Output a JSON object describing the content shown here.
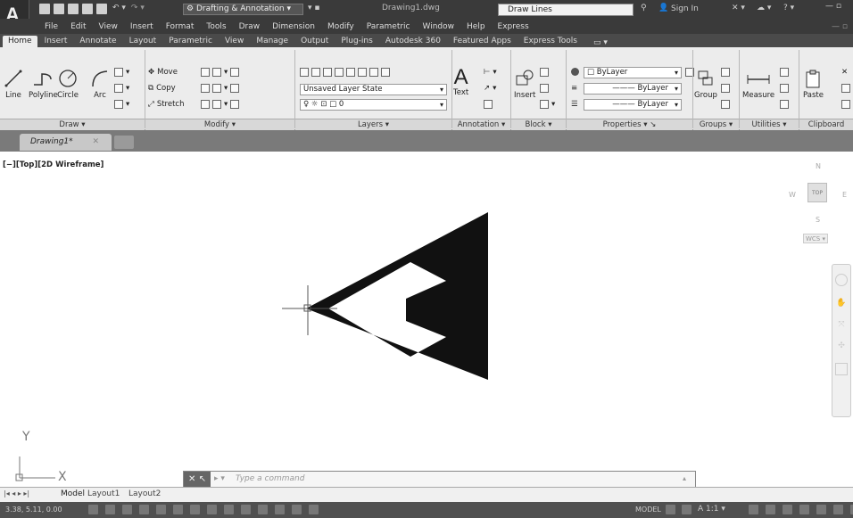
{
  "title_bar": {
    "workspace": "Drafting & Annotation",
    "filename": "Drawing1.dwg",
    "search_placeholder": "Draw Lines",
    "sign_in": "Sign In"
  },
  "menus": [
    "File",
    "Edit",
    "View",
    "Insert",
    "Format",
    "Tools",
    "Draw",
    "Dimension",
    "Modify",
    "Parametric",
    "Window",
    "Help",
    "Express"
  ],
  "ribbon_tabs": [
    "Home",
    "Insert",
    "Annotate",
    "Layout",
    "Parametric",
    "View",
    "Manage",
    "Output",
    "Plug-ins",
    "Autodesk 360",
    "Featured Apps",
    "Express Tools"
  ],
  "draw_tools": [
    "Line",
    "Polyline",
    "Circle",
    "Arc"
  ],
  "modify_tools": [
    "Move",
    "Copy",
    "Stretch"
  ],
  "layer_state": "Unsaved Layer State",
  "layer_current": "0",
  "annotation_tool": "Text",
  "block_tool": "Insert",
  "properties": {
    "color": "ByLayer",
    "linetype": "ByLayer",
    "lineweight": "ByLayer"
  },
  "group_tool": "Group",
  "measure_tool": "Measure",
  "paste_tool": "Paste",
  "panel_labels": [
    "Draw",
    "Modify",
    "Layers",
    "Annotation",
    "Block",
    "Properties",
    "Groups",
    "Utilities",
    "Clipboard"
  ],
  "document_tab": "Drawing1*",
  "viewport_label": "[−][Top][2D Wireframe]",
  "viewcube": {
    "n": "N",
    "s": "S",
    "e": "E",
    "w": "W",
    "top": "TOP",
    "wcs": "WCS"
  },
  "ucs": {
    "x": "X",
    "y": "Y"
  },
  "command_placeholder": "Type a command",
  "layout_tabs": [
    "Model",
    "Layout1",
    "Layout2"
  ],
  "status": {
    "coords": "3.38, 5.11, 0.00",
    "model": "MODEL",
    "scale": "1:1"
  }
}
